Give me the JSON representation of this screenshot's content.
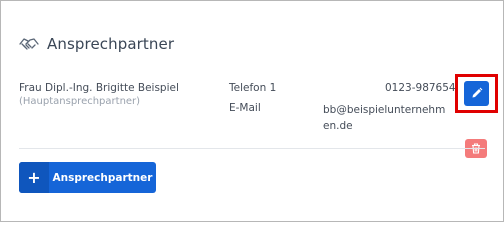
{
  "header": {
    "title": "Ansprechpartner",
    "icon": "handshake-icon"
  },
  "contact": {
    "name": "Frau Dipl.-Ing. Brigitte Beispiel",
    "role": "(Hauptansprechpartner)",
    "phone_label": "Telefon 1",
    "phone_value": "0123-987654",
    "email_label": "E-Mail",
    "email_value": "bb@beispielunternehmen.de"
  },
  "actions": {
    "edit_icon": "pencil-icon",
    "delete_icon": "trash-icon"
  },
  "add_button": {
    "label": "Ansprechpartner",
    "icon": "plus-icon"
  },
  "colors": {
    "primary": "#1565d8",
    "danger": "#f47b7b",
    "highlight": "#e00000"
  }
}
